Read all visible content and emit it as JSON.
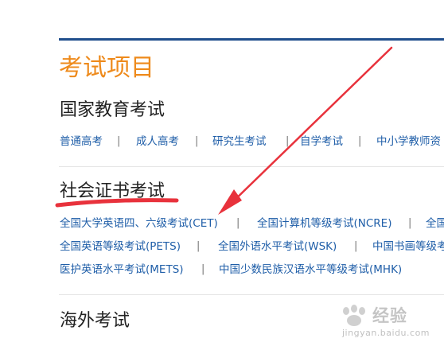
{
  "page": {
    "title": "考试项目"
  },
  "sections": [
    {
      "title": "国家教育考试",
      "rows": [
        [
          "普通高考",
          "成人高考",
          "研究生考试",
          "自学考试",
          "中小学教师资"
        ]
      ]
    },
    {
      "title": "社会证书考试",
      "rows": [
        [
          "全国大学英语四、六级考试(CET)",
          "全国计算机等级考试(NCRE)",
          "全国"
        ],
        [
          "全国英语等级考试(PETS)",
          "全国外语水平考试(WSK)",
          "中国书画等级考"
        ],
        [
          "医护英语水平考试(METS)",
          "中国少数民族汉语水平等级考试(MHK)"
        ]
      ]
    },
    {
      "title": "海外考试",
      "rows": []
    }
  ],
  "separator": "|",
  "annotation": {
    "color": "#e8323c"
  },
  "watermark": {
    "brand": "经验",
    "url": "jingyan.baidu.com"
  }
}
